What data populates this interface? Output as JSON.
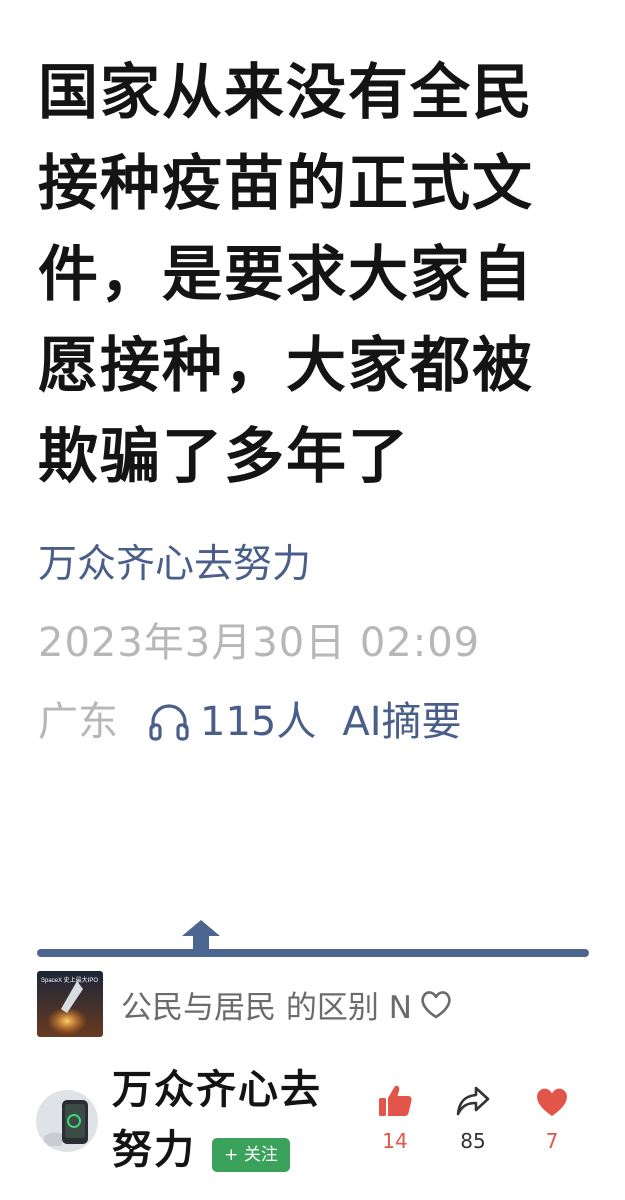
{
  "article": {
    "title": "国家从来没有全民接种疫苗的正式文件，是要求大家自愿接种，大家都被欺骗了多年了",
    "author": "万众齐心去努力",
    "date": "2023年3月30日 02:09",
    "location": "广东",
    "listen_count": "115人",
    "ai_summary_label": "AI摘要"
  },
  "related": {
    "text": "公民与居民 的区别 N",
    "thumb_caption": "SpaceX 史上最大IPO",
    "heart_icon": "heart-outline-icon"
  },
  "author_bar": {
    "name": "万众齐心去努力",
    "follow_label": "+ 关注",
    "likes": "14",
    "shares": "85",
    "favorites": "7"
  },
  "colors": {
    "link_blue": "#4a5e8a",
    "progress_blue": "#4d6690",
    "muted_gray": "#b7b7b7",
    "like_red": "#e25548",
    "follow_green": "#3aa25a"
  }
}
